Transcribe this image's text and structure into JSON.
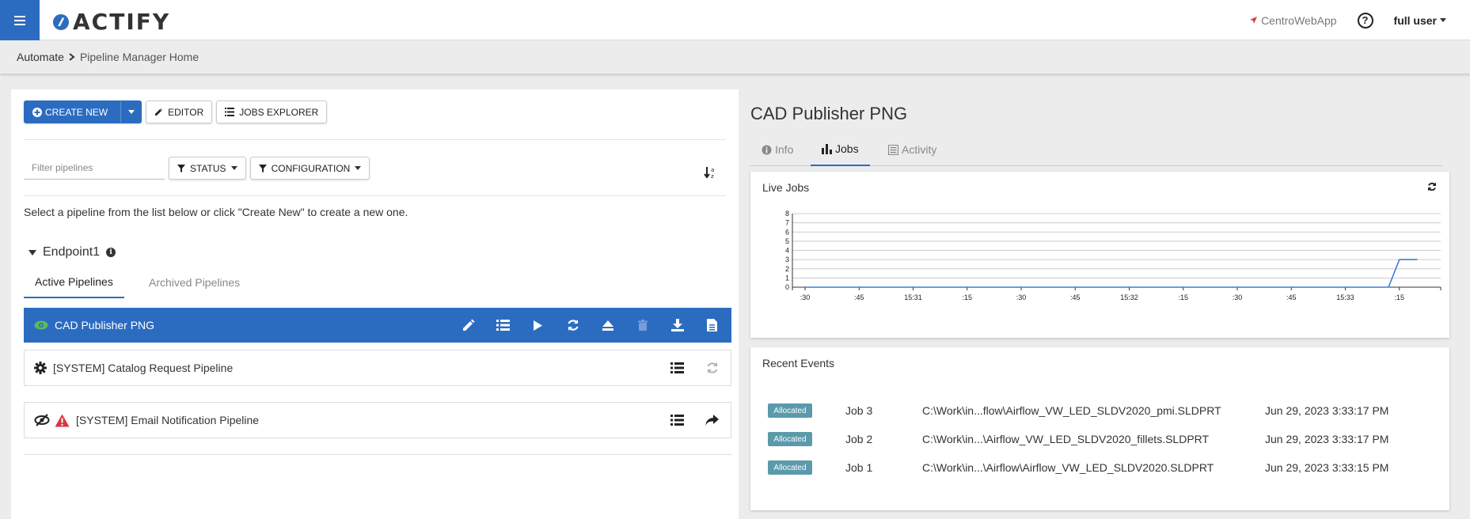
{
  "topbar": {
    "brand": "ACTIFY",
    "app_link": "CentroWebApp",
    "help": "?",
    "user": "full user"
  },
  "breadcrumb": {
    "root": "Automate",
    "current": "Pipeline Manager Home"
  },
  "toolbar": {
    "create_new": "CREATE NEW",
    "editor": "EDITOR",
    "jobs_explorer": "JOBS EXPLORER"
  },
  "filters": {
    "placeholder": "Filter pipelines",
    "status": "STATUS",
    "configuration": "CONFIGURATION"
  },
  "instructions": "Select a pipeline from the list below or click \"Create New\" to create a new one.",
  "group": {
    "name": "Endpoint1"
  },
  "tabs": {
    "active": "Active Pipelines",
    "archived": "Archived Pipelines"
  },
  "pipelines": [
    {
      "name": "CAD Publisher PNG"
    },
    {
      "name": "[SYSTEM] Catalog Request Pipeline"
    },
    {
      "name": "[SYSTEM] Email Notification Pipeline"
    }
  ],
  "detail": {
    "title": "CAD Publisher PNG",
    "tabs": {
      "info": "Info",
      "jobs": "Jobs",
      "activity": "Activity"
    }
  },
  "live_jobs": {
    "title": "Live Jobs"
  },
  "chart_data": {
    "type": "line",
    "ylim": [
      0,
      8
    ],
    "yticks": [
      "0",
      "1",
      "2",
      "3",
      "4",
      "5",
      "6",
      "7",
      "8"
    ],
    "xticks": [
      ":30",
      ":45",
      "15:31",
      ":15",
      ":30",
      ":45",
      "15:32",
      ":15",
      ":30",
      ":45",
      "15:33",
      ":15"
    ],
    "series": [
      {
        "x": [
          ":30",
          ":45",
          "15:31",
          ":15",
          ":30",
          ":45",
          "15:32",
          ":15",
          ":30",
          ":45",
          "15:33",
          ":12",
          ":15",
          ":20"
        ],
        "values": [
          0,
          0,
          0,
          0,
          0,
          0,
          0,
          0,
          0,
          0,
          0,
          0,
          3,
          3
        ]
      }
    ]
  },
  "recent_events": {
    "title": "Recent Events",
    "items": [
      {
        "status": "Allocated",
        "job": "Job 3",
        "path": "C:\\Work\\in...flow\\Airflow_VW_LED_SLDV2020_pmi.SLDPRT",
        "time": "Jun 29, 2023 3:33:17 PM"
      },
      {
        "status": "Allocated",
        "job": "Job 2",
        "path": "C:\\Work\\in...\\Airflow_VW_LED_SLDV2020_fillets.SLDPRT",
        "time": "Jun 29, 2023 3:33:17 PM"
      },
      {
        "status": "Allocated",
        "job": "Job 1",
        "path": "C:\\Work\\in...\\Airflow\\Airflow_VW_LED_SLDV2020.SLDPRT",
        "time": "Jun 29, 2023 3:33:15 PM"
      }
    ]
  },
  "colors": {
    "primary": "#2c6cc0",
    "badge": "#5a9aaa",
    "warning": "#d9363e",
    "eye": "#5cb85c"
  }
}
